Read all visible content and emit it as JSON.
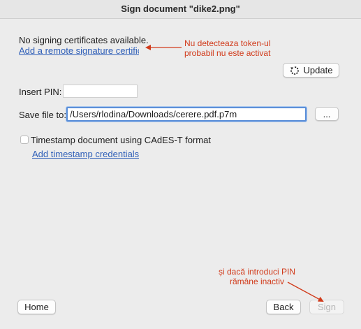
{
  "window": {
    "title": "Sign document \"dike2.png\"",
    "ghost_title": "····  ···· ·····"
  },
  "certificates": {
    "status_text": "No signing certificates available.",
    "add_remote_link": "Add a remote signature certificate",
    "update_button": "Update",
    "update_icon": "refresh-icon"
  },
  "form": {
    "pin_label": "Insert PIN:",
    "pin_value": "",
    "save_label": "Save file to:",
    "save_value": "/Users/rlodina/Downloads/cerere.pdf.p7m",
    "browse_button": "...",
    "timestamp_label": "Timestamp document using CAdES-T format",
    "timestamp_checked": false,
    "timestamp_link": "Add timestamp credentials"
  },
  "annotations": {
    "note1_line1": "Nu detecteaza token-ul",
    "note1_line2": "probabil nu este activat",
    "note2_line1": "și dacă introduci PIN",
    "note2_line2": "rămâne inactiv",
    "color": "#d13b1b"
  },
  "footer": {
    "home_button": "Home",
    "back_button": "Back",
    "sign_button": "Sign",
    "sign_enabled": false
  }
}
